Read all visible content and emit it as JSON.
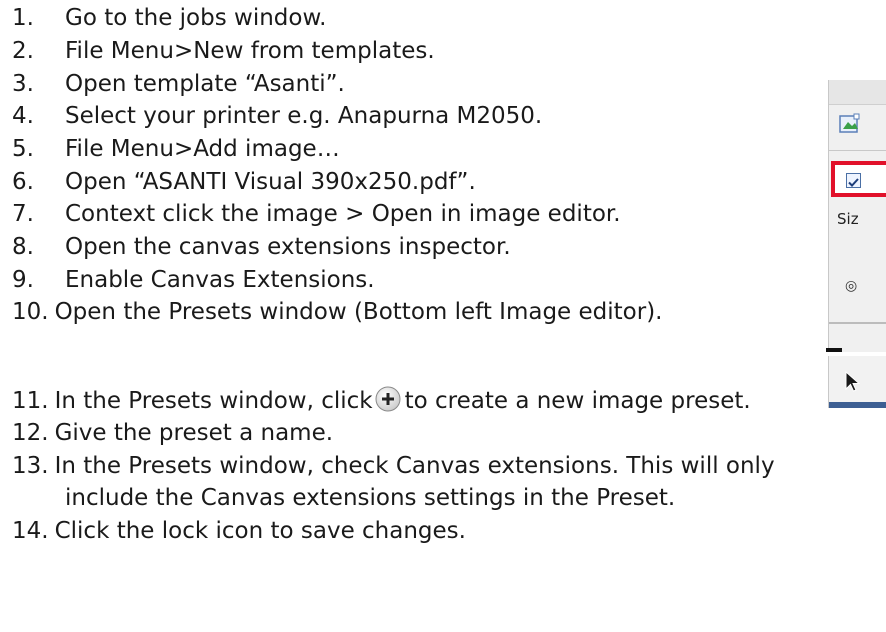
{
  "steps": [
    {
      "num": "1.",
      "text": "Go to the jobs window."
    },
    {
      "num": "2.",
      "text": "File Menu>New from templates."
    },
    {
      "num": "3.",
      "text": "Open template “Asanti”."
    },
    {
      "num": "4.",
      "text": "Select your printer e.g. Anapurna M2050."
    },
    {
      "num": "5.",
      "text": "File Menu>Add image…"
    },
    {
      "num": "6.",
      "text": "Open “ASANTI Visual 390x250.pdf”."
    },
    {
      "num": "7.",
      "text": "Context click the image > Open in image editor."
    },
    {
      "num": "8.",
      "text": "Open the canvas extensions inspector."
    },
    {
      "num": "9.",
      "text": "Enable Canvas Extensions."
    },
    {
      "num": "10.",
      "text": "Open the Presets window (Bottom left Image editor)."
    },
    {
      "num": "11.",
      "text_before": "In the Presets window, click",
      "icon": "add-circle-icon",
      "text_after": "to create a new image preset."
    },
    {
      "num": "12.",
      "text": "Give the preset a name."
    },
    {
      "num": "13.",
      "text": "In the Presets window, check Canvas extensions. This will only",
      "continuation": "include the Canvas extensions settings in the Preset."
    },
    {
      "num": "14.",
      "text": "Click the lock icon to save changes."
    }
  ],
  "screenshot_crop": {
    "label": "Siz",
    "radio_glyph": "◎",
    "highlight_color": "#e1102a",
    "checkbox_checked": true
  },
  "colors": {
    "text": "#1a1a1a",
    "highlight": "#e1102a",
    "accent_bar": "#3d5f93"
  }
}
